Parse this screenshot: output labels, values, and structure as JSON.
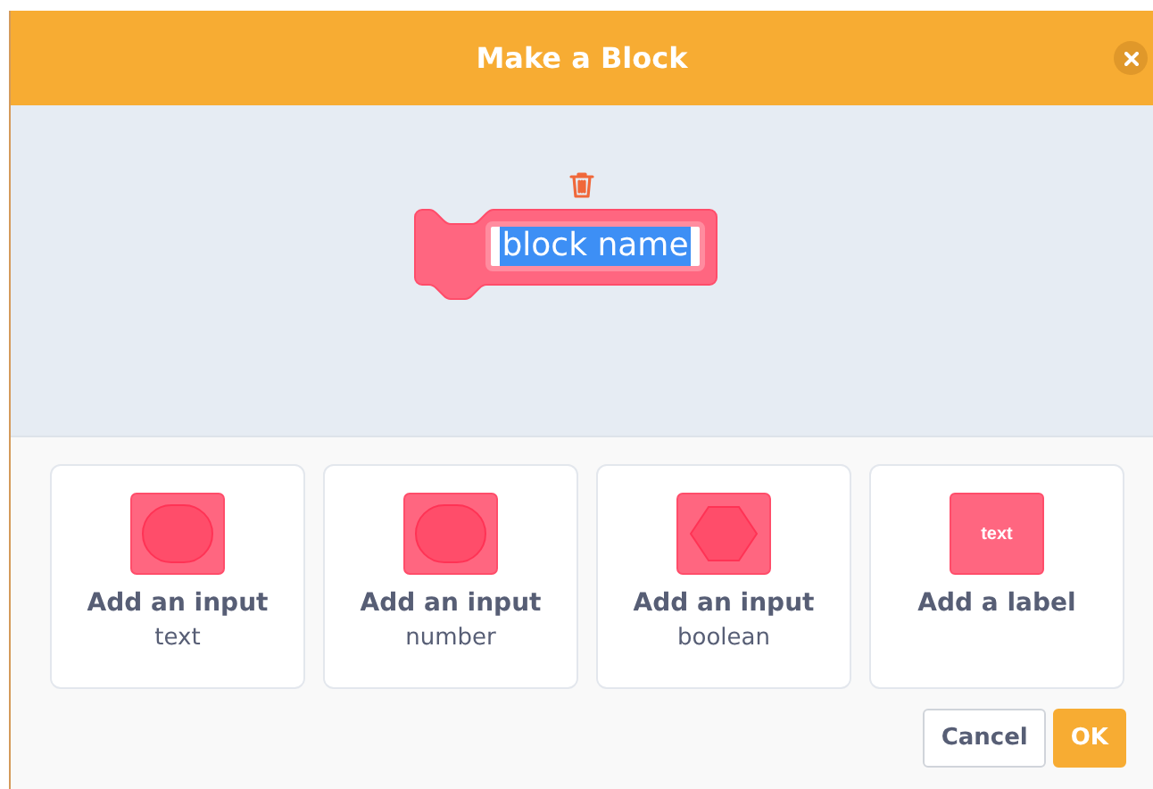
{
  "dialog": {
    "title": "Make a Block"
  },
  "block": {
    "name": "block name",
    "selected": true
  },
  "options": [
    {
      "kind": "round",
      "title": "Add an input",
      "subtitle": "text"
    },
    {
      "kind": "round",
      "title": "Add an input",
      "subtitle": "number"
    },
    {
      "kind": "hexagon",
      "title": "Add an input",
      "subtitle": "boolean"
    },
    {
      "kind": "label",
      "icon_text": "text",
      "title": "Add a label"
    }
  ],
  "buttons": [
    {
      "label": "Cancel",
      "kind": "secondary"
    },
    {
      "label": "OK",
      "kind": "primary"
    }
  ]
}
